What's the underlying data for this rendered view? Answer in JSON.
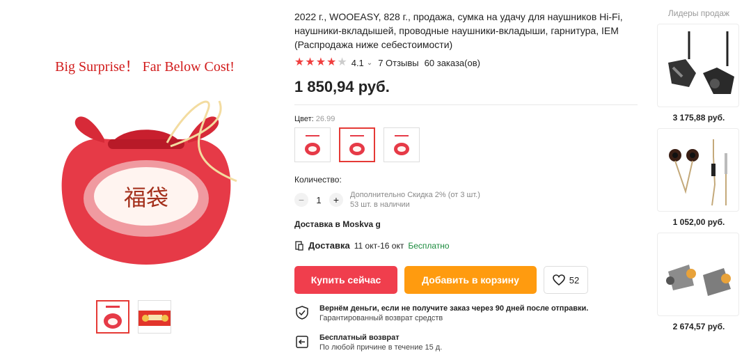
{
  "gallery": {
    "main_headline": "Big Surprise！ Far Below Cost!",
    "bag_text": "福袋",
    "thumbnail_count": 2
  },
  "product": {
    "title": "2022 г., WOOEASY, 828 г., продажа, сумка на удачу для наушников Hi-Fi, наушники-вкладышей, проводные наушники-вкладыши, гарнитура, IEM (Распродажа ниже себестоимости)",
    "rating": "4.1",
    "rating_fraction": 0.82,
    "reviews": "7 Отзывы",
    "orders": "60 заказа(ов)",
    "price": "1 850,94 руб."
  },
  "color": {
    "label": "Цвет:",
    "value": "26.99"
  },
  "quantity": {
    "label": "Количество:",
    "minus": "−",
    "value": "1",
    "plus": "+",
    "discount_note": "Дополнительно Скидка 2% (от 3 шт.)",
    "stock_note": "53 шт. в наличии"
  },
  "delivery": {
    "to_label": "Доставка в Moskva g",
    "label": "Доставка",
    "dates": "11 окт-16 окт",
    "price": "Бесплатно"
  },
  "actions": {
    "buy_label": "Купить сейчас",
    "cart_label": "Добавить в корзину",
    "wishlist_count": "52"
  },
  "guarantees": [
    {
      "title": "Вернём деньги, если не получите заказ через 90 дней после отправки.",
      "subtitle": "Гарантированный возврат средств",
      "icon": "shield-check-icon"
    },
    {
      "title": "Бесплатный возврат",
      "subtitle": "По любой причине в течение 15 д.",
      "icon": "return-icon"
    }
  ],
  "bestsellers": {
    "title": "Лидеры продаж",
    "items": [
      {
        "price": "3 175,88 руб."
      },
      {
        "price": "1 052,00 руб."
      },
      {
        "price": "2 674,57 руб."
      }
    ]
  },
  "colors": {
    "accent_red": "#f03e4d",
    "accent_orange": "#ff9b0f",
    "free_green": "#1a8a3c"
  }
}
